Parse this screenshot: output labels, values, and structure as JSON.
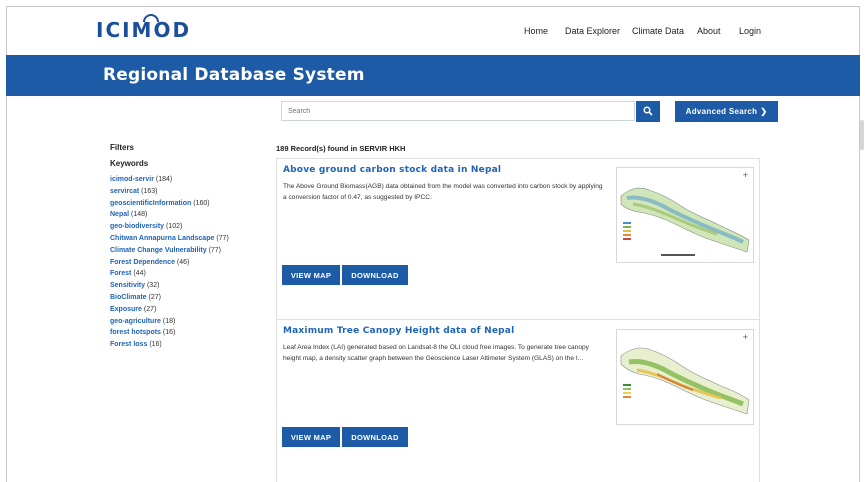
{
  "brand": {
    "logo_text": "ICIMOD"
  },
  "nav": {
    "items": [
      "Home",
      "Data Explorer",
      "Climate Data",
      "About",
      "Login"
    ]
  },
  "banner": {
    "title": "Regional Database System"
  },
  "search": {
    "placeholder": "Search",
    "advanced_label": "Advanced Search"
  },
  "sidebar": {
    "filters_title": "Filters",
    "keywords_title": "Keywords",
    "keywords": [
      {
        "label": "icimod-servir",
        "count": "(184)"
      },
      {
        "label": "servircat",
        "count": "(163)"
      },
      {
        "label": "geoscientificInformation",
        "count": "(160)"
      },
      {
        "label": "Nepal",
        "count": "(148)"
      },
      {
        "label": "geo-biodiversity",
        "count": "(102)"
      },
      {
        "label": "Chitwan Annapurna Landscape",
        "count": "(77)"
      },
      {
        "label": "Climate Change Vulnerability",
        "count": "(77)"
      },
      {
        "label": "Forest Dependence",
        "count": "(46)"
      },
      {
        "label": "Forest",
        "count": "(44)"
      },
      {
        "label": "Sensitivity",
        "count": "(32)"
      },
      {
        "label": "BioClimate",
        "count": "(27)"
      },
      {
        "label": "Exposure",
        "count": "(27)"
      },
      {
        "label": "geo-agriculture",
        "count": "(18)"
      },
      {
        "label": "forest hotspots",
        "count": "(16)"
      },
      {
        "label": "Forest loss",
        "count": "(16)"
      }
    ]
  },
  "results": {
    "summary": "189 Record(s) found in SERVIR HKH",
    "items": [
      {
        "title": "Above ground carbon stock data in Nepal",
        "description": "The Above Ground Biomass(AGB) data obtained from the model was converted into carbon stock by applying a conversion factor of 0.47, as suggested by IPCC.",
        "view_label": "VIEW MAP",
        "download_label": "DOWNLOAD"
      },
      {
        "title": "Maximum Tree Canopy Height data of Nepal",
        "description": "Leaf Area Index (LAI) generated based on Landsat-8 the OLI cloud free images. To generate tree canopy height map, a density scatter graph between the Geoscience Laser Altimeter System (GLAS) on the I...",
        "view_label": "VIEW MAP",
        "download_label": "DOWNLOAD"
      }
    ]
  },
  "colors": {
    "primary": "#1d5ba6",
    "link": "#1f64b5"
  },
  "icons": {
    "search": "search-icon",
    "chevron": "chevron-down-icon",
    "expand": "plus-icon"
  }
}
